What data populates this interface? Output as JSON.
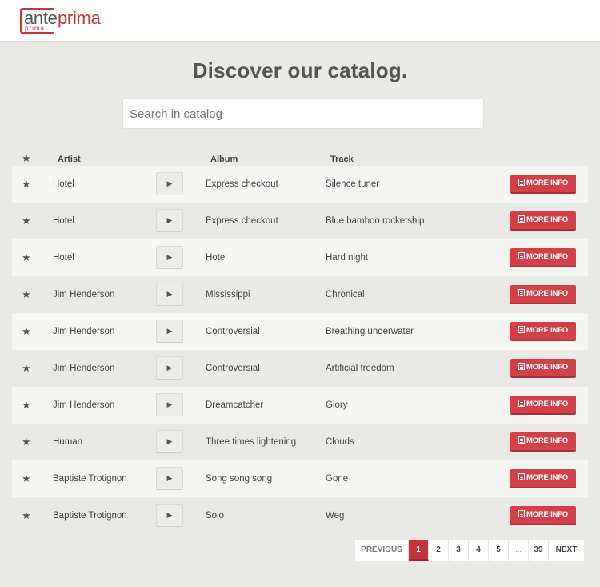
{
  "brand": {
    "word_ante": "ante",
    "word_prima": "prima",
    "tag": "prima",
    "accent_color": "#c4343a"
  },
  "page": {
    "title": "Discover our catalog."
  },
  "search": {
    "placeholder": "Search in catalog",
    "value": ""
  },
  "table": {
    "headers": {
      "star": "★",
      "artist": "Artist",
      "album": "Album",
      "track": "Track"
    },
    "star_glyph": "★",
    "play_glyph": "▶",
    "more_info_label": "MORE INFO",
    "rows": [
      {
        "artist": "Hotel",
        "album": "Express checkout",
        "track": "Silence tuner"
      },
      {
        "artist": "Hotel",
        "album": "Express checkout",
        "track": "Blue bamboo rocketship"
      },
      {
        "artist": "Hotel",
        "album": "Hotel",
        "track": "Hard night"
      },
      {
        "artist": "Jim Henderson",
        "album": "Mississippi",
        "track": "Chronical"
      },
      {
        "artist": "Jim Henderson",
        "album": "Controversial",
        "track": "Breathing underwater"
      },
      {
        "artist": "Jim Henderson",
        "album": "Controversial",
        "track": "Artificial freedom"
      },
      {
        "artist": "Jim Henderson",
        "album": "Dreamcatcher",
        "track": "Glory"
      },
      {
        "artist": "Human",
        "album": "Three times lightening",
        "track": "Clouds"
      },
      {
        "artist": "Baptiste Trotignon",
        "album": "Song song song",
        "track": "Gone"
      },
      {
        "artist": "Baptiste Trotignon",
        "album": "Solo",
        "track": "Weg"
      }
    ]
  },
  "pagination": {
    "previous": "PREVIOUS",
    "next": "NEXT",
    "pages": [
      "1",
      "2",
      "3",
      "4",
      "5",
      "...",
      "39"
    ],
    "current": "1"
  }
}
